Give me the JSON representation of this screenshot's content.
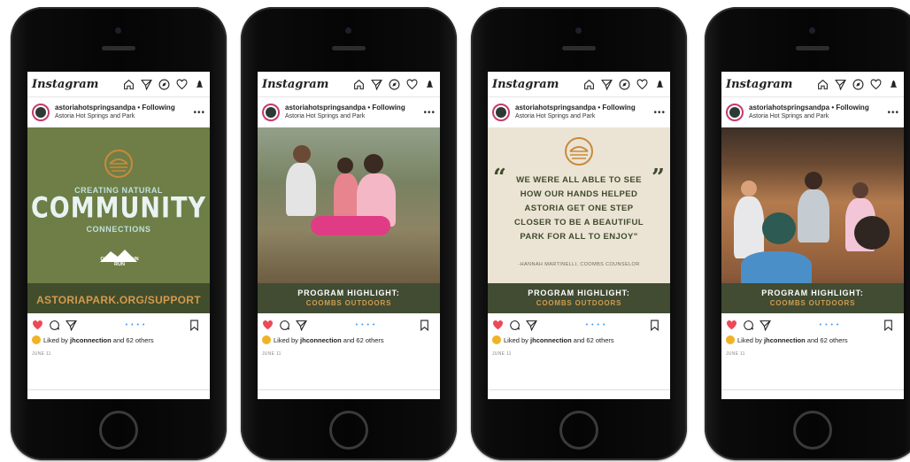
{
  "app": {
    "logo": "Instagram"
  },
  "colors": {
    "olive": "#6e7e46",
    "dark_olive": "#414c33",
    "gold": "#d39b4c",
    "beige": "#ebe4d4",
    "like": "#ed4956"
  },
  "nav_icons": [
    "home-icon",
    "send-icon",
    "explore-icon",
    "heart-icon",
    "activity-icon"
  ],
  "posts": [
    {
      "username": "astoriahotspringsandpa",
      "following": "Following",
      "location": "Astoria Hot Springs and Park",
      "image": {
        "line1": "CREATING NATURAL",
        "line2": "COMMUNITY",
        "line3": "CONNECTIONS",
        "badge": "OLD BILL'S FUN RUN",
        "url": "ASTORIAPARK.ORG/SUPPORT"
      },
      "pager": "• • • •",
      "liked_prefix": "Liked by",
      "liked_user": "jhconnection",
      "liked_suffix": "and 62 others",
      "date": "JUNE 11"
    },
    {
      "username": "astoriahotspringsandpa",
      "following": "Following",
      "location": "Astoria Hot Springs and Park",
      "image": {
        "highlight": "PROGRAM HIGHLIGHT:",
        "sub": "COOMBS OUTDOORS"
      },
      "pager": "• • • •",
      "liked_prefix": "Liked by",
      "liked_user": "jhconnection",
      "liked_suffix": "and 62 others",
      "date": "JUNE 11"
    },
    {
      "username": "astoriahotspringsandpa",
      "following": "Following",
      "location": "Astoria Hot Springs and Park",
      "image": {
        "quote_open": "“",
        "quote_close": "”",
        "quote": "WE WERE ALL ABLE TO SEE HOW OUR HANDS HELPED ASTORIA GET ONE STEP CLOSER TO BE A BEAUTIFUL PARK FOR ALL TO ENJOY\"",
        "author": "-HANNAH MARTINELLI, COOMBS COUNSELOR",
        "highlight": "PROGRAM HIGHLIGHT:",
        "sub": "COOMBS OUTDOORS"
      },
      "pager": "• • • •",
      "liked_prefix": "Liked by",
      "liked_user": "jhconnection",
      "liked_suffix": "and 62 others",
      "date": "JUNE 11"
    },
    {
      "username": "astoriahotspringsandpa",
      "following": "Following",
      "location": "Astoria Hot Springs and Park",
      "image": {
        "highlight": "PROGRAM HIGHLIGHT:",
        "sub": "COOMBS OUTDOORS"
      },
      "pager": "• • • •",
      "liked_prefix": "Liked by",
      "liked_user": "jhconnection",
      "liked_suffix": "and 62 others",
      "date": "JUNE 11"
    }
  ]
}
